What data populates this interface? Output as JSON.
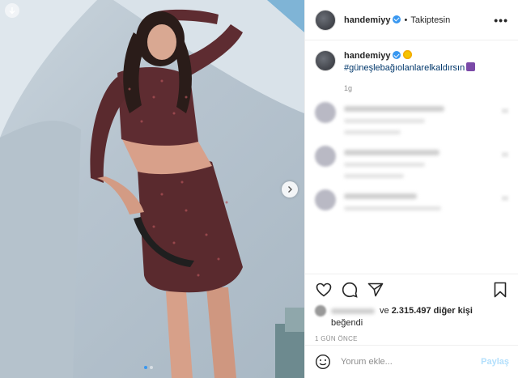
{
  "post": {
    "username": "handemiyy",
    "separator": "•",
    "follow_status": "Takiptesin",
    "more": "•••",
    "caption_hashtag": "#güneşlebağıolanlarelkaldırsın",
    "caption_time": "1g",
    "likes_prefix": "ve",
    "likes_count": "2.315.497 diğer kişi",
    "liked_word": "beğendi",
    "post_age": "1 GÜN ÖNCE",
    "comment_placeholder": "Yorum ekle...",
    "post_button": "Paylaş"
  },
  "carousel": {
    "total": 2,
    "current": 1
  },
  "colors": {
    "accent": "#3897f0",
    "link": "#00376b",
    "muted": "#8e8e8e",
    "post_disabled": "#b2dffc"
  },
  "icons": [
    "back-arrow-icon",
    "chevron-right-icon",
    "verified-badge-icon",
    "heart-icon",
    "comment-icon",
    "share-icon",
    "bookmark-icon",
    "emoji-icon"
  ]
}
